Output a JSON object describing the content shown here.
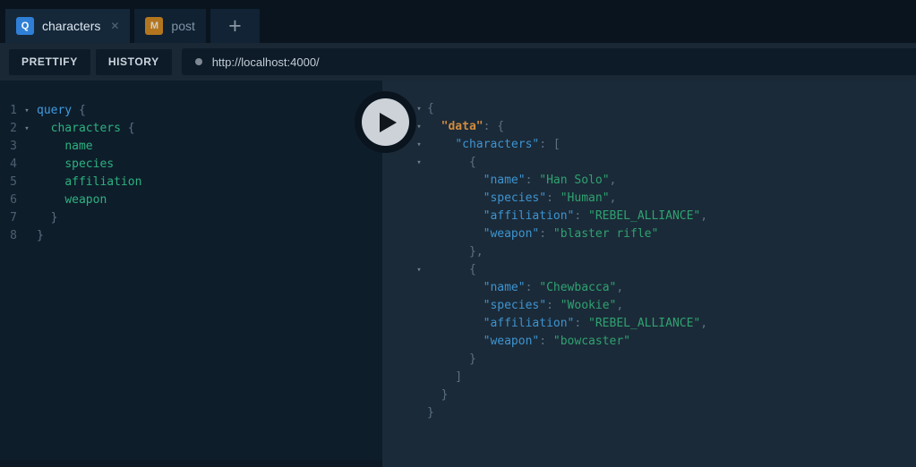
{
  "tabs": [
    {
      "badge": "Q",
      "label": "characters",
      "closable": true
    },
    {
      "badge": "M",
      "label": "post",
      "closable": false
    }
  ],
  "icons": {
    "close": "✕",
    "new_tab": "+",
    "fold_arrow": "▾"
  },
  "toolbar": {
    "prettify_label": "PRETTIFY",
    "history_label": "HISTORY",
    "url": "http://localhost:4000/"
  },
  "colors": {
    "keyword_blue": "#3f9be0",
    "field_green": "#2db180",
    "punctuation_gray": "#5c7082",
    "json_key_blue": "#3e94d0",
    "json_key_orange": "#d08b3e",
    "json_string_green": "#2fa271",
    "tab_badge_query": "#2f7fd6",
    "tab_badge_mutation": "#b3761e"
  },
  "editor": {
    "lines": [
      {
        "n": "1",
        "fold": true,
        "segs": [
          [
            "query",
            "kw"
          ],
          [
            " {",
            "p"
          ]
        ]
      },
      {
        "n": "2",
        "fold": true,
        "segs": [
          [
            "  ",
            "p"
          ],
          [
            "characters",
            "fld"
          ],
          [
            " {",
            "p"
          ]
        ]
      },
      {
        "n": "3",
        "fold": false,
        "segs": [
          [
            "    ",
            "p"
          ],
          [
            "name",
            "fld"
          ]
        ]
      },
      {
        "n": "4",
        "fold": false,
        "segs": [
          [
            "    ",
            "p"
          ],
          [
            "species",
            "fld"
          ]
        ]
      },
      {
        "n": "5",
        "fold": false,
        "segs": [
          [
            "    ",
            "p"
          ],
          [
            "affiliation",
            "fld"
          ]
        ]
      },
      {
        "n": "6",
        "fold": false,
        "segs": [
          [
            "    ",
            "p"
          ],
          [
            "weapon",
            "fld"
          ]
        ]
      },
      {
        "n": "7",
        "fold": false,
        "segs": [
          [
            "  }",
            "p"
          ]
        ]
      },
      {
        "n": "8",
        "fold": false,
        "segs": [
          [
            "}",
            "p"
          ]
        ]
      }
    ]
  },
  "response": {
    "lines": [
      {
        "fold": true,
        "segs": [
          [
            "{",
            "p"
          ]
        ]
      },
      {
        "fold": true,
        "segs": [
          [
            "  ",
            "p"
          ],
          [
            "\"data\"",
            "ko"
          ],
          [
            ": {",
            "p"
          ]
        ]
      },
      {
        "fold": true,
        "segs": [
          [
            "    ",
            "p"
          ],
          [
            "\"characters\"",
            "kb"
          ],
          [
            ": [",
            "p"
          ]
        ]
      },
      {
        "fold": true,
        "segs": [
          [
            "      {",
            "p"
          ]
        ]
      },
      {
        "fold": false,
        "segs": [
          [
            "        ",
            "p"
          ],
          [
            "\"name\"",
            "kb"
          ],
          [
            ": ",
            "p"
          ],
          [
            "\"Han Solo\"",
            "sv"
          ],
          [
            ",",
            "p"
          ]
        ]
      },
      {
        "fold": false,
        "segs": [
          [
            "        ",
            "p"
          ],
          [
            "\"species\"",
            "kb"
          ],
          [
            ": ",
            "p"
          ],
          [
            "\"Human\"",
            "sv"
          ],
          [
            ",",
            "p"
          ]
        ]
      },
      {
        "fold": false,
        "segs": [
          [
            "        ",
            "p"
          ],
          [
            "\"affiliation\"",
            "kb"
          ],
          [
            ": ",
            "p"
          ],
          [
            "\"REBEL_ALLIANCE\"",
            "sv"
          ],
          [
            ",",
            "p"
          ]
        ]
      },
      {
        "fold": false,
        "segs": [
          [
            "        ",
            "p"
          ],
          [
            "\"weapon\"",
            "kb"
          ],
          [
            ": ",
            "p"
          ],
          [
            "\"blaster rifle\"",
            "sv"
          ]
        ]
      },
      {
        "fold": false,
        "segs": [
          [
            "      },",
            "p"
          ]
        ]
      },
      {
        "fold": true,
        "segs": [
          [
            "      {",
            "p"
          ]
        ]
      },
      {
        "fold": false,
        "segs": [
          [
            "        ",
            "p"
          ],
          [
            "\"name\"",
            "kb"
          ],
          [
            ": ",
            "p"
          ],
          [
            "\"Chewbacca\"",
            "sv"
          ],
          [
            ",",
            "p"
          ]
        ]
      },
      {
        "fold": false,
        "segs": [
          [
            "        ",
            "p"
          ],
          [
            "\"species\"",
            "kb"
          ],
          [
            ": ",
            "p"
          ],
          [
            "\"Wookie\"",
            "sv"
          ],
          [
            ",",
            "p"
          ]
        ]
      },
      {
        "fold": false,
        "segs": [
          [
            "        ",
            "p"
          ],
          [
            "\"affiliation\"",
            "kb"
          ],
          [
            ": ",
            "p"
          ],
          [
            "\"REBEL_ALLIANCE\"",
            "sv"
          ],
          [
            ",",
            "p"
          ]
        ]
      },
      {
        "fold": false,
        "segs": [
          [
            "        ",
            "p"
          ],
          [
            "\"weapon\"",
            "kb"
          ],
          [
            ": ",
            "p"
          ],
          [
            "\"bowcaster\"",
            "sv"
          ]
        ]
      },
      {
        "fold": false,
        "segs": [
          [
            "      }",
            "p"
          ]
        ]
      },
      {
        "fold": false,
        "segs": [
          [
            "    ]",
            "p"
          ]
        ]
      },
      {
        "fold": false,
        "segs": [
          [
            "  }",
            "p"
          ]
        ]
      },
      {
        "fold": false,
        "segs": [
          [
            "}",
            "p"
          ]
        ]
      }
    ]
  }
}
